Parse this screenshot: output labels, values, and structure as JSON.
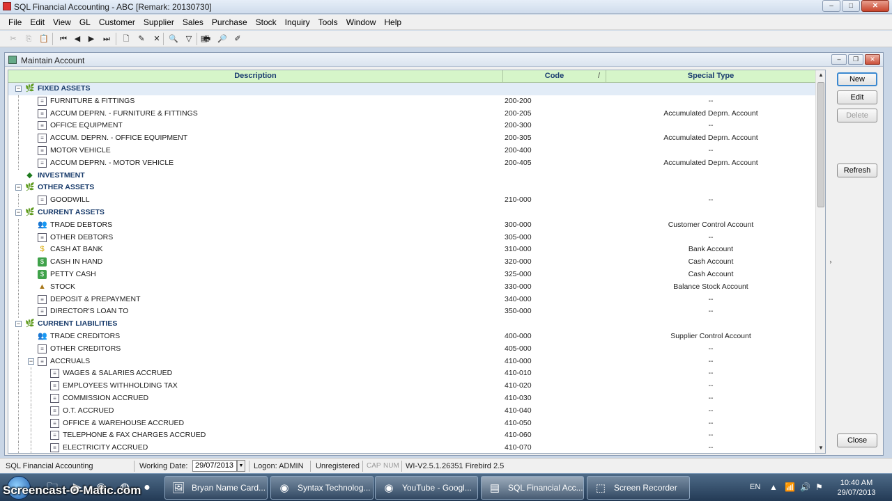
{
  "window": {
    "title": "SQL Financial Accounting - ABC [Remark: 20130730]",
    "controls": {
      "minimize": "–",
      "maximize": "□",
      "close": "✕"
    }
  },
  "menu": [
    "File",
    "Edit",
    "View",
    "GL",
    "Customer",
    "Supplier",
    "Sales",
    "Purchase",
    "Stock",
    "Inquiry",
    "Tools",
    "Window",
    "Help"
  ],
  "toolbar": {
    "icons": [
      "scissors-icon",
      "copy-icon",
      "paste-icon",
      "first-record-icon",
      "prior-record-icon",
      "next-record-icon",
      "last-record-icon",
      "new-doc-icon",
      "edit-doc-icon",
      "delete-doc-icon",
      "find-icon",
      "filter-icon",
      "clear-icon",
      "print-icon",
      "preview-icon",
      "design-icon"
    ],
    "glyphs": [
      "✂",
      "⎘",
      "📋",
      "⏮",
      "◀",
      "▶",
      "⏭",
      "🗋",
      "✎",
      "✕",
      "🔍",
      "▽",
      "▤",
      "🖶",
      "🔎",
      "✐"
    ]
  },
  "child_window": {
    "title": "Maintain Account",
    "controls": {
      "minimize": "–",
      "restore": "❐",
      "close": "✕"
    }
  },
  "grid": {
    "columns": {
      "description": "Description",
      "code": "Code",
      "code_sort": "/",
      "special_type": "Special Type"
    },
    "rows": [
      {
        "desc": "FIXED ASSETS",
        "code": "",
        "type": "",
        "bold": true,
        "level": 0,
        "expander": "−",
        "icon": "grp",
        "glyph": "🌿",
        "selected": true
      },
      {
        "desc": "FURNITURE & FITTINGS",
        "code": "200-200",
        "type": "--",
        "level": 1,
        "icon": "doc",
        "glyph": "≡"
      },
      {
        "desc": "ACCUM DEPRN. - FURNITURE & FITTINGS",
        "code": "200-205",
        "type": "Accumulated Deprn. Account",
        "level": 1,
        "icon": "doc",
        "glyph": "≡"
      },
      {
        "desc": "OFFICE EQUIPMENT",
        "code": "200-300",
        "type": "--",
        "level": 1,
        "icon": "doc",
        "glyph": "≡"
      },
      {
        "desc": "ACCUM. DEPRN. - OFFICE EQUIPMENT",
        "code": "200-305",
        "type": "Accumulated Deprn. Account",
        "level": 1,
        "icon": "doc",
        "glyph": "≡"
      },
      {
        "desc": "MOTOR VEHICLE",
        "code": "200-400",
        "type": "--",
        "level": 1,
        "icon": "doc",
        "glyph": "≡"
      },
      {
        "desc": "ACCUM DEPRN. - MOTOR VEHICLE",
        "code": "200-405",
        "type": "Accumulated Deprn. Account",
        "level": 1,
        "icon": "doc",
        "glyph": "≡"
      },
      {
        "desc": "INVESTMENT",
        "code": "",
        "type": "",
        "bold": true,
        "level": 0,
        "icon": "grp",
        "glyph": "◆"
      },
      {
        "desc": "OTHER ASSETS",
        "code": "",
        "type": "",
        "bold": true,
        "level": 0,
        "expander": "−",
        "icon": "grp",
        "glyph": "🌿"
      },
      {
        "desc": "GOODWILL",
        "code": "210-000",
        "type": "--",
        "level": 1,
        "icon": "doc",
        "glyph": "≡"
      },
      {
        "desc": "CURRENT ASSETS",
        "code": "",
        "type": "",
        "bold": true,
        "level": 0,
        "expander": "−",
        "icon": "grp",
        "glyph": "🌿"
      },
      {
        "desc": "TRADE DEBTORS",
        "code": "300-000",
        "type": "Customer Control Account",
        "level": 1,
        "icon": "ppl",
        "glyph": "👥"
      },
      {
        "desc": "OTHER DEBTORS",
        "code": "305-000",
        "type": "--",
        "level": 1,
        "icon": "doc",
        "glyph": "≡"
      },
      {
        "desc": "CASH AT BANK",
        "code": "310-000",
        "type": "Bank Account",
        "level": 1,
        "icon": "coin",
        "glyph": "$"
      },
      {
        "desc": "CASH IN HAND",
        "code": "320-000",
        "type": "Cash Account",
        "level": 1,
        "icon": "money",
        "glyph": "$"
      },
      {
        "desc": "PETTY CASH",
        "code": "325-000",
        "type": "Cash Account",
        "level": 1,
        "icon": "money",
        "glyph": "$"
      },
      {
        "desc": "STOCK",
        "code": "330-000",
        "type": "Balance Stock Account",
        "level": 1,
        "icon": "stock",
        "glyph": "▲"
      },
      {
        "desc": "DEPOSIT & PREPAYMENT",
        "code": "340-000",
        "type": "--",
        "level": 1,
        "icon": "doc",
        "glyph": "≡"
      },
      {
        "desc": "DIRECTOR'S LOAN TO",
        "code": "350-000",
        "type": "--",
        "level": 1,
        "icon": "doc",
        "glyph": "≡"
      },
      {
        "desc": "CURRENT LIABILITIES",
        "code": "",
        "type": "",
        "bold": true,
        "level": 0,
        "expander": "−",
        "icon": "ppl",
        "glyph": "🌿"
      },
      {
        "desc": "TRADE CREDITORS",
        "code": "400-000",
        "type": "Supplier Control Account",
        "level": 1,
        "icon": "ppl",
        "glyph": "👥"
      },
      {
        "desc": "OTHER CREDITORS",
        "code": "405-000",
        "type": "--",
        "level": 1,
        "icon": "doc",
        "glyph": "≡"
      },
      {
        "desc": "ACCRUALS",
        "code": "410-000",
        "type": "--",
        "level": 1,
        "expander": "−",
        "icon": "doc",
        "glyph": "≡"
      },
      {
        "desc": "WAGES & SALARIES ACCRUED",
        "code": "410-010",
        "type": "--",
        "level": 2,
        "icon": "doc",
        "glyph": "≡"
      },
      {
        "desc": "EMPLOYEES WITHHOLDING TAX",
        "code": "410-020",
        "type": "--",
        "level": 2,
        "icon": "doc",
        "glyph": "≡"
      },
      {
        "desc": "COMMISSION ACCRUED",
        "code": "410-030",
        "type": "--",
        "level": 2,
        "icon": "doc",
        "glyph": "≡"
      },
      {
        "desc": "O.T. ACCRUED",
        "code": "410-040",
        "type": "--",
        "level": 2,
        "icon": "doc",
        "glyph": "≡"
      },
      {
        "desc": "OFFICE & WAREHOUSE ACCRUED",
        "code": "410-050",
        "type": "--",
        "level": 2,
        "icon": "doc",
        "glyph": "≡"
      },
      {
        "desc": "TELEPHONE & FAX CHARGES ACCRUED",
        "code": "410-060",
        "type": "--",
        "level": 2,
        "icon": "doc",
        "glyph": "≡"
      },
      {
        "desc": "ELECTRICITY ACCRUED",
        "code": "410-070",
        "type": "--",
        "level": 2,
        "icon": "doc",
        "glyph": "≡"
      }
    ]
  },
  "actions": {
    "new": "New",
    "edit": "Edit",
    "delete": "Delete",
    "refresh": "Refresh",
    "close": "Close"
  },
  "statusbar": {
    "app": "SQL Financial Accounting",
    "working_date_label": "Working Date:",
    "working_date": "29/07/2013",
    "logon": "Logon: ADMIN",
    "registration": "Unregistered",
    "caps": "CAP",
    "num": "NUM",
    "version": "WI-V2.5.1.26351 Firebird 2.5"
  },
  "taskbar": {
    "watermark": "Screencast-O-Matic.com",
    "tasks": [
      {
        "label": "Bryan Name Card...",
        "glyph": "🖼"
      },
      {
        "label": "Syntax Technolog...",
        "glyph": "◉"
      },
      {
        "label": "YouTube - Googl...",
        "glyph": "◉"
      },
      {
        "label": "SQL Financial Acc...",
        "glyph": "▤",
        "active": true
      },
      {
        "label": "Screen Recorder",
        "glyph": "⬚"
      }
    ],
    "language": "EN",
    "time": "10:40 AM",
    "date": "29/07/2013"
  }
}
